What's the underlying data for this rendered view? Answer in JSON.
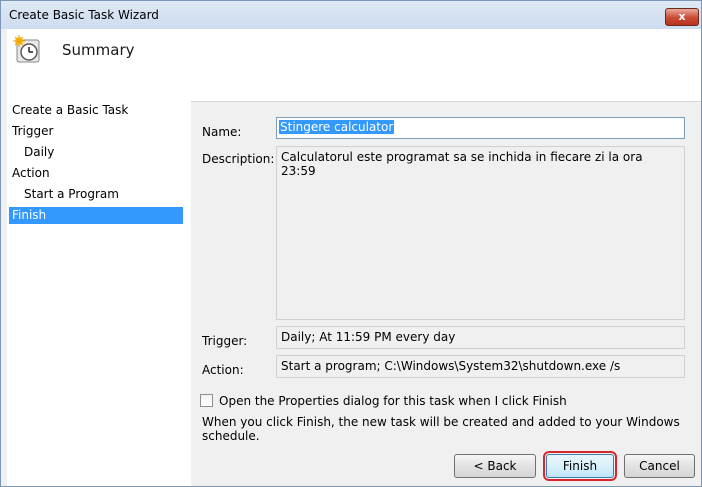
{
  "window": {
    "title": "Create Basic Task Wizard"
  },
  "header": {
    "title": "Summary",
    "icon": "task-clock-icon"
  },
  "sidebar": {
    "items": [
      {
        "label": "Create a Basic Task",
        "sub": false,
        "active": false
      },
      {
        "label": "Trigger",
        "sub": false,
        "active": false
      },
      {
        "label": "Daily",
        "sub": true,
        "active": false
      },
      {
        "label": "Action",
        "sub": false,
        "active": false
      },
      {
        "label": "Start a Program",
        "sub": true,
        "active": false
      },
      {
        "label": "Finish",
        "sub": false,
        "active": true
      }
    ]
  },
  "form": {
    "name_label": "Name:",
    "name_value": "Stingere calculator",
    "description_label": "Description:",
    "description_value": "Calculatorul este programat sa se inchida in fiecare zi la ora 23:59",
    "trigger_label": "Trigger:",
    "trigger_value": "Daily; At 11:59 PM every day",
    "action_label": "Action:",
    "action_value": "Start a program; C:\\Windows\\System32\\shutdown.exe /s",
    "open_properties_label": "Open the Properties dialog for this task when I click Finish",
    "open_properties_checked": false,
    "info_text": "When you click Finish, the new task will be created and added to your Windows schedule."
  },
  "buttons": {
    "back": "< Back",
    "finish": "Finish",
    "cancel": "Cancel",
    "close": "x"
  },
  "colors": {
    "selection": "#3399ff",
    "finish_highlight": "#d9262c"
  }
}
